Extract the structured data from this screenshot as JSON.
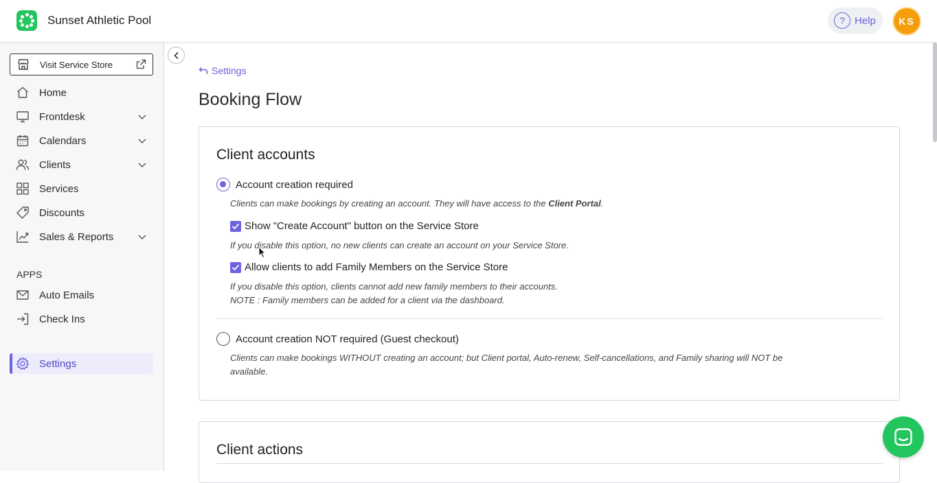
{
  "header": {
    "app_title": "Sunset Athletic Pool",
    "help_label": "Help",
    "avatar_initials": "KS",
    "brand_color": "#22c55e",
    "accent_color": "#6b63e0",
    "avatar_color": "#f59e0b"
  },
  "sidebar": {
    "visit_store_label": "Visit Service Store",
    "items": [
      {
        "label": "Home",
        "icon": "home-icon",
        "has_chevron": false
      },
      {
        "label": "Frontdesk",
        "icon": "monitor-icon",
        "has_chevron": true
      },
      {
        "label": "Calendars",
        "icon": "calendar-icon",
        "has_chevron": true
      },
      {
        "label": "Clients",
        "icon": "users-icon",
        "has_chevron": true
      },
      {
        "label": "Services",
        "icon": "grid-icon",
        "has_chevron": false
      },
      {
        "label": "Discounts",
        "icon": "tag-icon",
        "has_chevron": false
      },
      {
        "label": "Sales & Reports",
        "icon": "chart-icon",
        "has_chevron": true
      }
    ],
    "apps_heading": "APPS",
    "apps": [
      {
        "label": "Auto Emails",
        "icon": "mail-icon"
      },
      {
        "label": "Check Ins",
        "icon": "check-in-icon"
      }
    ],
    "settings_label": "Settings",
    "active_item": "Settings"
  },
  "main": {
    "back_label": "Settings",
    "page_title": "Booking Flow",
    "client_accounts": {
      "title": "Client accounts",
      "option_required": {
        "label": "Account creation required",
        "selected": true,
        "desc_prefix": "Clients can make bookings by creating an account. They will have access to the ",
        "desc_bold": "Client Portal",
        "desc_suffix": "."
      },
      "checkbox_create_account": {
        "label": "Show \"Create Account\" button on the Service Store",
        "checked": true,
        "desc": "If you disable this option, no new clients can create an account on your Service Store."
      },
      "checkbox_family": {
        "label": "Allow clients to add Family Members on the Service Store",
        "checked": true,
        "desc_line1": "If you disable this option, clients cannot add new family members to their accounts.",
        "desc_line2": "NOTE : Family members can be added for a client via the dashboard."
      },
      "option_guest": {
        "label": "Account creation NOT required (Guest checkout)",
        "selected": false,
        "desc_line1": "Clients can make bookings WITHOUT creating an account; but Client portal, Auto-renew, Self-cancellations, and Family sharing will NOT be",
        "desc_line2": "available."
      }
    },
    "client_actions": {
      "title": "Client actions"
    }
  }
}
